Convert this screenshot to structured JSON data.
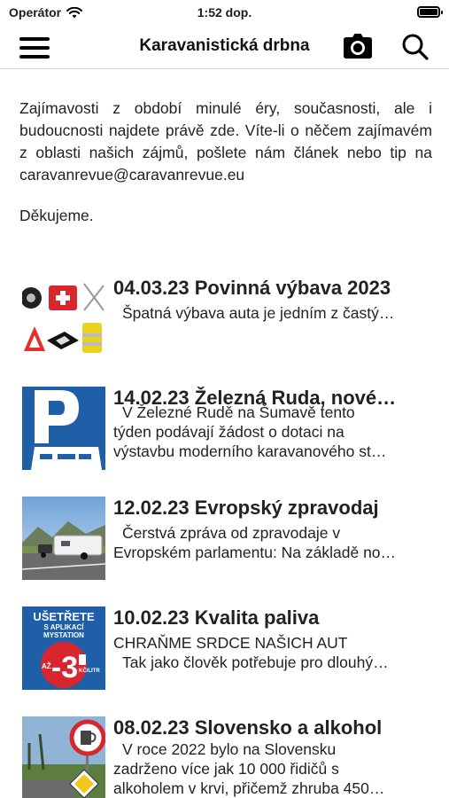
{
  "status_bar": {
    "carrier": "Operátor",
    "time": "1:52 dop."
  },
  "nav": {
    "title": "Karavanistická drbna"
  },
  "intro": {
    "text": "Zajímavosti z období minulé éry, současnosti, ale i budoucnosti najdete právě zde. Víte-li o něčem zajímavém z oblasti našich zájmů, pošlete nám článek nebo tip na caravanrevue@caravanrevue.eu",
    "thanks": "Děkujeme."
  },
  "articles": [
    {
      "title": "04.03.23 Povinná výbava 2023",
      "excerpt_lines": [
        "",
        "",
        "Špatná výbava auta je jedním z častý…"
      ],
      "thumb_icon": "car-equipment-thumbnail"
    },
    {
      "title": "14.02.23 Železná Ruda, nové…",
      "excerpt_lines": [
        "V Železné Rudě na Šumavě tento",
        "týden podávají žádost o dotaci na",
        "výstavbu moderního karavanového st…"
      ],
      "thumb_icon": "parking-sign-thumbnail"
    },
    {
      "title": "12.02.23 Evropský zpravodaj",
      "excerpt_lines": [
        "",
        "Čerstvá zpráva od zpravodaje v",
        "Evropském parlamentu: Na základě no…"
      ],
      "thumb_icon": "caravan-road-thumbnail"
    },
    {
      "title": "10.02.23 Kvalita paliva",
      "excerpt_lines": [
        "",
        "CHRAŇME SRDCE NAŠICH AUT",
        "Tak jako člověk potřebuje pro dlouhý…"
      ],
      "thumb_icon": "fuel-discount-thumbnail",
      "thumb_text": {
        "line1": "UŠETŘETE",
        "line2": "S APLIKACÍ",
        "line3": "MYSTATION",
        "az": "AŽ",
        "num": "-3",
        "unit": "KČ/LITR"
      }
    },
    {
      "title": "08.02.23 Slovensko a alkohol",
      "excerpt_lines": [
        "V roce 2022 bylo na Slovensku",
        "zadrženo více jak 10 000 řidičů s",
        "alkoholem v krvi, přičemž zhruba 450…"
      ],
      "thumb_icon": "alcohol-sign-thumbnail"
    }
  ],
  "colors": {
    "accent_blue": "#1e5fa8",
    "red": "#d7262e",
    "text": "#222222"
  }
}
